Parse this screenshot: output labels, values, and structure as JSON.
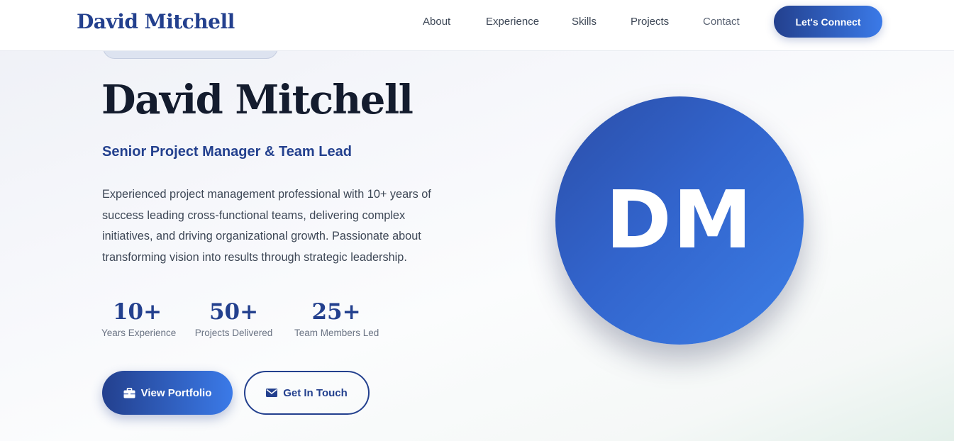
{
  "header": {
    "brand": "David Mitchell",
    "nav": {
      "about": "About",
      "experience": "Experience",
      "skills": "Skills",
      "projects": "Projects",
      "contact": "Contact"
    },
    "cta_label": "Let's Connect"
  },
  "hero": {
    "title": "David Mitchell",
    "subtitle": "Senior Project Manager & Team Lead",
    "description": "Experienced project management professional with 10+ years of success leading cross-functional teams, delivering complex initiatives, and driving organizational growth. Passionate about transforming vision into results through strategic leadership.",
    "stats": [
      {
        "value": "10+",
        "label": "Years Experience"
      },
      {
        "value": "50+",
        "label": "Projects Delivered"
      },
      {
        "value": "25+",
        "label": "Team Members Led"
      }
    ],
    "buttons": {
      "primary": {
        "label": "View Portfolio",
        "icon": "briefcase-icon"
      },
      "secondary": {
        "label": "Get In Touch",
        "icon": "envelope-icon"
      }
    },
    "avatar_initials": "DM"
  },
  "colors": {
    "brand": "#23408e",
    "accent": "#3b7ae8",
    "heading": "#141c2e",
    "body_text": "#3d4756"
  }
}
